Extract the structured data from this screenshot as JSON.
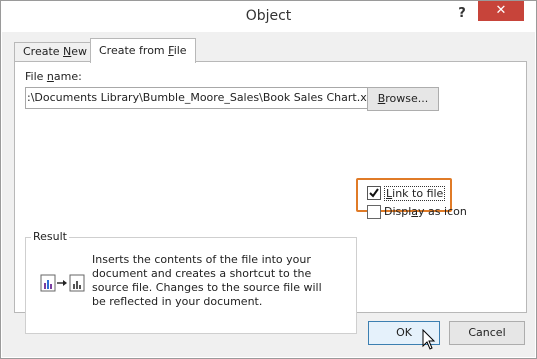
{
  "window": {
    "title": "Object",
    "help_label": "?",
    "close_label": "✕"
  },
  "tabs": [
    {
      "label_prefix": "Create ",
      "label_access": "N",
      "label_suffix": "ew"
    },
    {
      "label_prefix": "Create from ",
      "label_access": "F",
      "label_suffix": "ile"
    }
  ],
  "file_name": {
    "label_prefix": "File ",
    "label_access": "n",
    "label_suffix": "ame:",
    "value": ":\\Documents Library\\Bumble_Moore_Sales\\Book Sales Chart.xlsx"
  },
  "browse_button": {
    "label_access": "B",
    "label_suffix": "rowse..."
  },
  "link_to_file": {
    "label_access": "L",
    "label_suffix": "ink to file",
    "checked": true
  },
  "display_as_icon": {
    "label_prefix": "Displ",
    "label_access": "a",
    "label_suffix": "y as icon",
    "checked": false
  },
  "result": {
    "title": "Result",
    "text": "Inserts the contents of the file into your document and creates a shortcut to the source file.  Changes to the source file will be reflected in your document."
  },
  "buttons": {
    "ok": "OK",
    "cancel": "Cancel"
  },
  "colors": {
    "highlight": "#e07b27",
    "close_button": "#c7443a",
    "chart_purple": "#7b3fa0",
    "chart_blue": "#2f6fd6"
  }
}
